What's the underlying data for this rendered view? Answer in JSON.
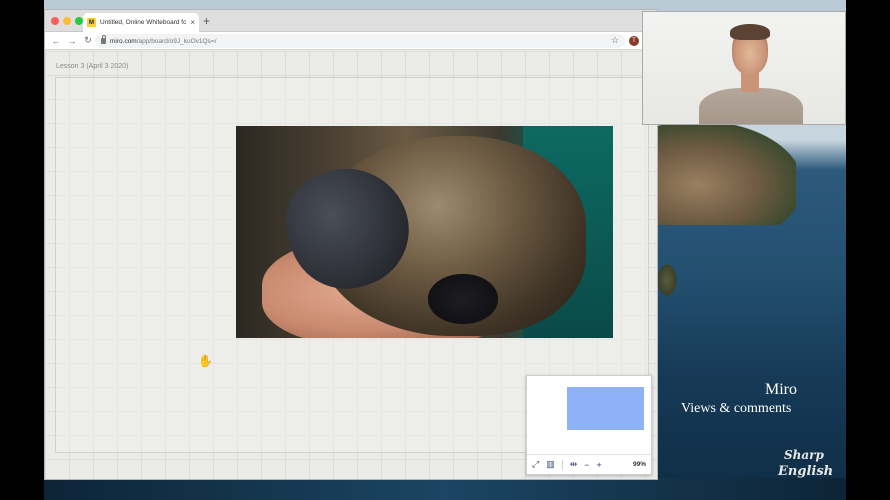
{
  "browser": {
    "tab": {
      "title": "Untitled, Online Whiteboard for V",
      "favicon_letter": "M",
      "close_label": "×"
    },
    "new_tab_label": "+",
    "nav": {
      "back": "←",
      "forward": "→",
      "reload": "↻"
    },
    "url": {
      "host": "miro.com",
      "path": "/app/board/o9J_kuOv1Qs=/"
    },
    "bookmark_icon": "☆",
    "profile_initial": "T"
  },
  "board": {
    "frame_label": "Lesson 3 (April 3 2020)",
    "hand_cursor": "✋"
  },
  "minimap": {
    "fullscreen_icon": "⤢",
    "map_icon": "▥",
    "fit_icon": "⇹",
    "zoom_out": "−",
    "zoom_in": "+",
    "zoom_level": "99%"
  },
  "overlay": {
    "title": "Miro",
    "subtitle": "Views & comments"
  },
  "watermark": {
    "line1": "Sharp",
    "line2": "English"
  }
}
